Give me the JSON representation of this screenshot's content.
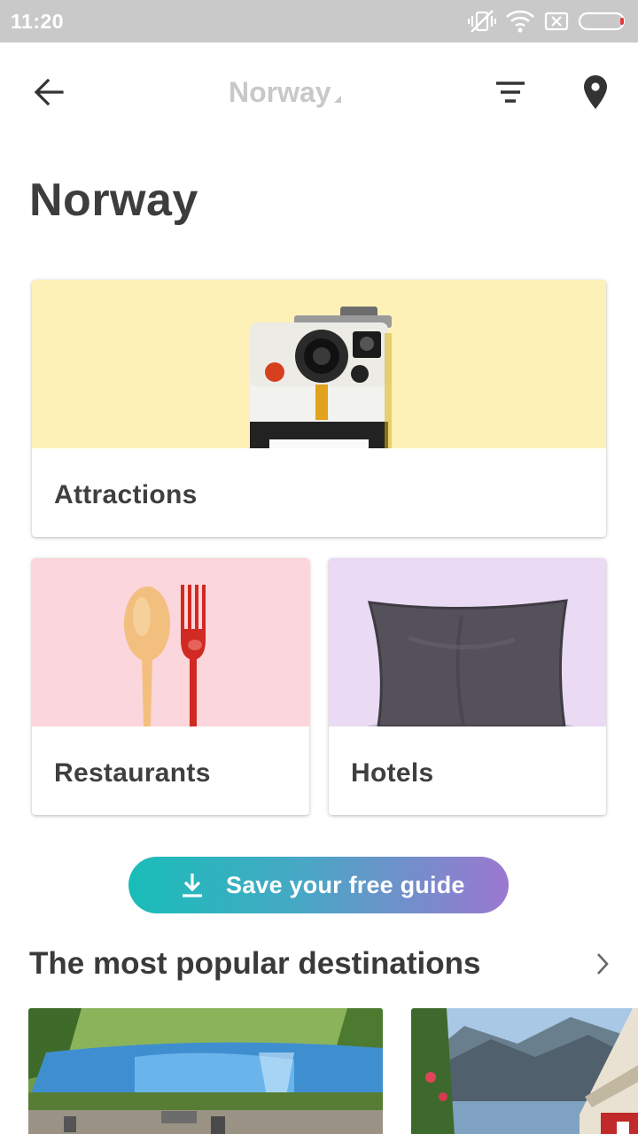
{
  "status_bar": {
    "time": "11:20",
    "icons": [
      "vibrate-off-icon",
      "wifi-icon",
      "sim-none-icon",
      "battery-icon"
    ]
  },
  "app_bar": {
    "back_icon": "arrow-left-icon",
    "title": "Norway",
    "filter_icon": "filter-icon",
    "map_icon": "map-pin-icon"
  },
  "page": {
    "title": "Norway"
  },
  "categories": [
    {
      "label": "Attractions",
      "image": "instant-camera",
      "bg_color": "#fdf1b8"
    },
    {
      "label": "Restaurants",
      "image": "spoon-and-fork",
      "bg_color": "#fbd6dc"
    },
    {
      "label": "Hotels",
      "image": "pillow",
      "bg_color": "#ebdaf3"
    }
  ],
  "save_guide": {
    "label": "Save your free guide",
    "icon": "download-icon",
    "gradient": [
      "#19bdb8",
      "#9b78d0"
    ]
  },
  "popular": {
    "title": "The most popular destinations",
    "chevron_icon": "chevron-right-icon",
    "destinations": [
      {
        "image": "lake-park-photo"
      },
      {
        "image": "fjord-red-house-photo"
      }
    ]
  }
}
